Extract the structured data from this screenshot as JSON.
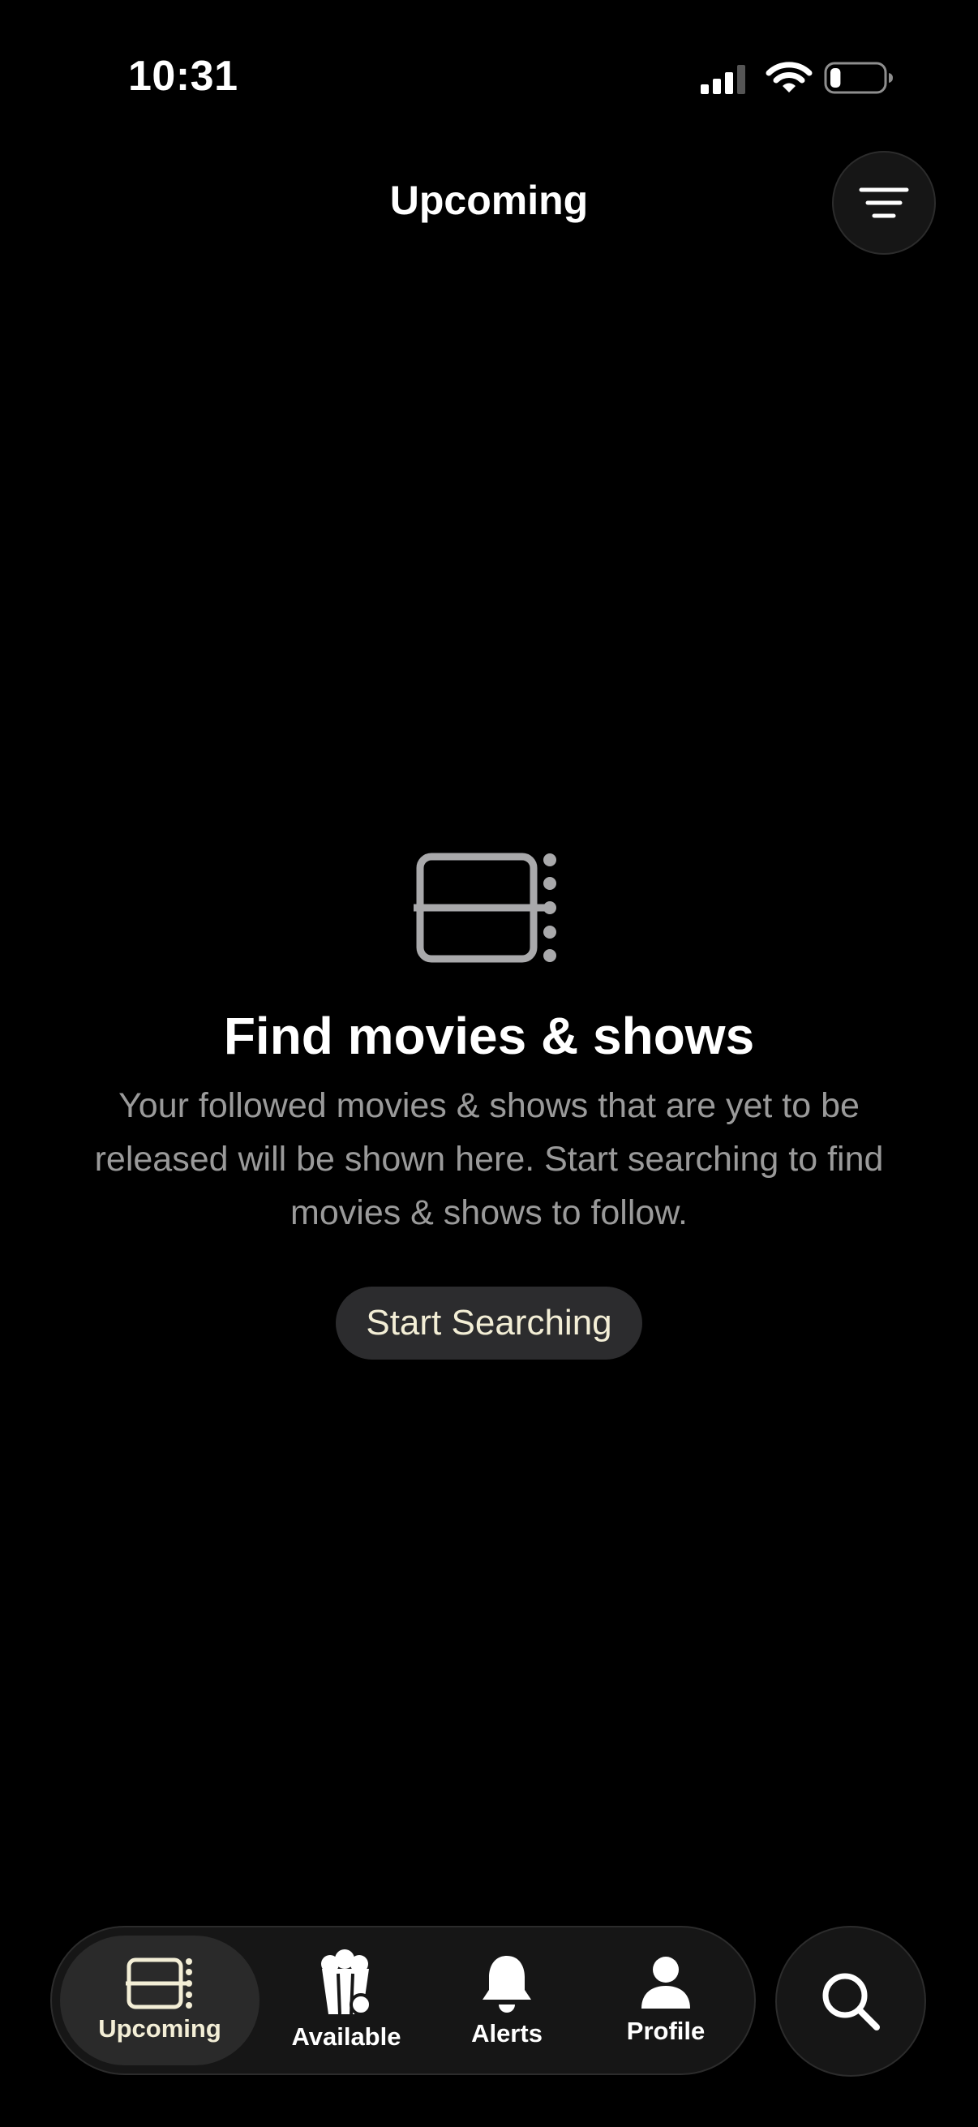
{
  "status_bar": {
    "time": "10:31",
    "signal_icon": "cellular-signal-icon",
    "wifi_icon": "wifi-icon",
    "battery_icon": "battery-icon",
    "battery_level": 0.2
  },
  "header": {
    "title": "Upcoming",
    "filter_icon": "filter-lines-icon"
  },
  "empty_state": {
    "icon": "film-strip-icon",
    "title": "Find movies & shows",
    "description": "Your followed movies & shows that are yet to be released will be shown here. Start searching to find movies & shows to follow.",
    "button_label": "Start Searching"
  },
  "tab_bar": {
    "items": [
      {
        "label": "Upcoming",
        "icon": "film-strip-icon",
        "active": true
      },
      {
        "label": "Available",
        "icon": "popcorn-icon",
        "active": false
      },
      {
        "label": "Alerts",
        "icon": "bell-icon",
        "active": false
      },
      {
        "label": "Profile",
        "icon": "person-icon",
        "active": false
      }
    ],
    "search_icon": "search-icon"
  },
  "colors": {
    "background": "#000000",
    "accent": "#f3eed6",
    "secondary_text": "#9a9a9a",
    "button_bg": "#2c2c2e"
  }
}
